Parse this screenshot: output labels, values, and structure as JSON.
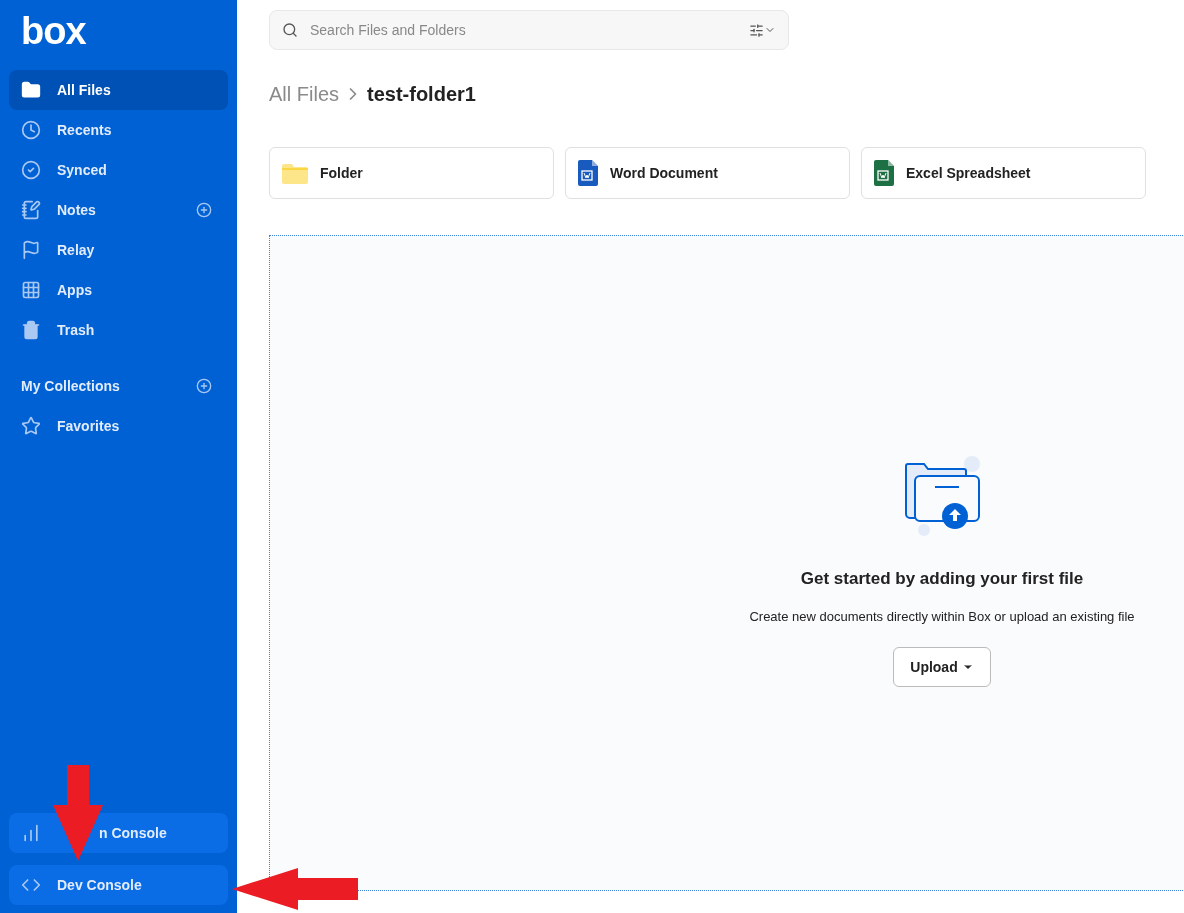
{
  "logo": "box",
  "sidebar": {
    "items": [
      {
        "label": "All Files",
        "kind": "folder",
        "selected": true,
        "addable": false
      },
      {
        "label": "Recents",
        "kind": "clock",
        "selected": false,
        "addable": false
      },
      {
        "label": "Synced",
        "kind": "check",
        "selected": false,
        "addable": false
      },
      {
        "label": "Notes",
        "kind": "notes",
        "selected": false,
        "addable": true
      },
      {
        "label": "Relay",
        "kind": "flag",
        "selected": false,
        "addable": false
      },
      {
        "label": "Apps",
        "kind": "grid",
        "selected": false,
        "addable": false
      },
      {
        "label": "Trash",
        "kind": "trash",
        "selected": false,
        "addable": false
      }
    ],
    "collections": {
      "title": "My Collections",
      "items": [
        {
          "label": "Favorites",
          "kind": "star",
          "selected": false,
          "addable": false
        }
      ]
    },
    "footer": [
      {
        "label": "n Console",
        "kind": "chart",
        "covered": true
      },
      {
        "label": "Dev Console",
        "kind": "code"
      }
    ]
  },
  "search": {
    "placeholder": "Search Files and Folders"
  },
  "breadcrumb": [
    {
      "label": "All Files",
      "current": false
    },
    {
      "label": "test-folder1",
      "current": true
    }
  ],
  "create": [
    {
      "label": "Folder",
      "kind": "folder"
    },
    {
      "label": "Word Document",
      "kind": "word"
    },
    {
      "label": "Excel Spreadsheet",
      "kind": "excel"
    }
  ],
  "empty_state": {
    "title": "Get started by adding your first file",
    "text": "Create new documents directly within Box or upload an existing file",
    "button": "Upload"
  },
  "annotations": [
    {
      "kind": "down-arrow"
    },
    {
      "kind": "left-arrow"
    }
  ]
}
